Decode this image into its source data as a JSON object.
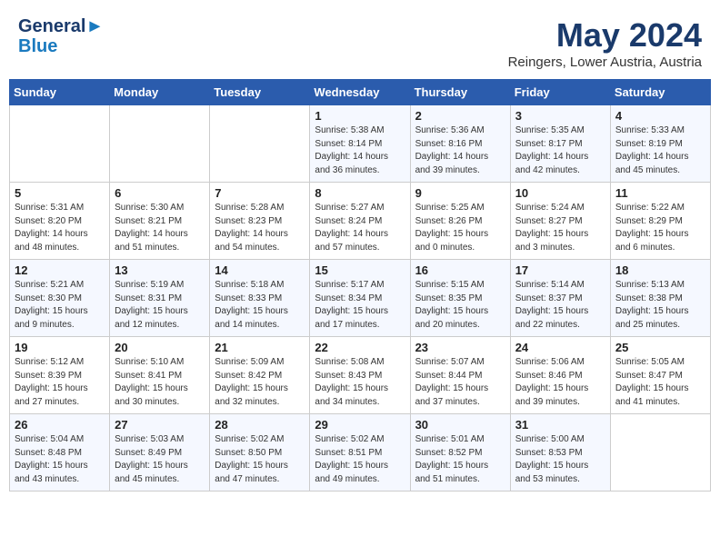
{
  "header": {
    "logo_line1": "General",
    "logo_line2": "Blue",
    "title": "May 2024",
    "subtitle": "Reingers, Lower Austria, Austria"
  },
  "weekdays": [
    "Sunday",
    "Monday",
    "Tuesday",
    "Wednesday",
    "Thursday",
    "Friday",
    "Saturday"
  ],
  "weeks": [
    [
      {
        "day": "",
        "info": ""
      },
      {
        "day": "",
        "info": ""
      },
      {
        "day": "",
        "info": ""
      },
      {
        "day": "1",
        "info": "Sunrise: 5:38 AM\nSunset: 8:14 PM\nDaylight: 14 hours\nand 36 minutes."
      },
      {
        "day": "2",
        "info": "Sunrise: 5:36 AM\nSunset: 8:16 PM\nDaylight: 14 hours\nand 39 minutes."
      },
      {
        "day": "3",
        "info": "Sunrise: 5:35 AM\nSunset: 8:17 PM\nDaylight: 14 hours\nand 42 minutes."
      },
      {
        "day": "4",
        "info": "Sunrise: 5:33 AM\nSunset: 8:19 PM\nDaylight: 14 hours\nand 45 minutes."
      }
    ],
    [
      {
        "day": "5",
        "info": "Sunrise: 5:31 AM\nSunset: 8:20 PM\nDaylight: 14 hours\nand 48 minutes."
      },
      {
        "day": "6",
        "info": "Sunrise: 5:30 AM\nSunset: 8:21 PM\nDaylight: 14 hours\nand 51 minutes."
      },
      {
        "day": "7",
        "info": "Sunrise: 5:28 AM\nSunset: 8:23 PM\nDaylight: 14 hours\nand 54 minutes."
      },
      {
        "day": "8",
        "info": "Sunrise: 5:27 AM\nSunset: 8:24 PM\nDaylight: 14 hours\nand 57 minutes."
      },
      {
        "day": "9",
        "info": "Sunrise: 5:25 AM\nSunset: 8:26 PM\nDaylight: 15 hours\nand 0 minutes."
      },
      {
        "day": "10",
        "info": "Sunrise: 5:24 AM\nSunset: 8:27 PM\nDaylight: 15 hours\nand 3 minutes."
      },
      {
        "day": "11",
        "info": "Sunrise: 5:22 AM\nSunset: 8:29 PM\nDaylight: 15 hours\nand 6 minutes."
      }
    ],
    [
      {
        "day": "12",
        "info": "Sunrise: 5:21 AM\nSunset: 8:30 PM\nDaylight: 15 hours\nand 9 minutes."
      },
      {
        "day": "13",
        "info": "Sunrise: 5:19 AM\nSunset: 8:31 PM\nDaylight: 15 hours\nand 12 minutes."
      },
      {
        "day": "14",
        "info": "Sunrise: 5:18 AM\nSunset: 8:33 PM\nDaylight: 15 hours\nand 14 minutes."
      },
      {
        "day": "15",
        "info": "Sunrise: 5:17 AM\nSunset: 8:34 PM\nDaylight: 15 hours\nand 17 minutes."
      },
      {
        "day": "16",
        "info": "Sunrise: 5:15 AM\nSunset: 8:35 PM\nDaylight: 15 hours\nand 20 minutes."
      },
      {
        "day": "17",
        "info": "Sunrise: 5:14 AM\nSunset: 8:37 PM\nDaylight: 15 hours\nand 22 minutes."
      },
      {
        "day": "18",
        "info": "Sunrise: 5:13 AM\nSunset: 8:38 PM\nDaylight: 15 hours\nand 25 minutes."
      }
    ],
    [
      {
        "day": "19",
        "info": "Sunrise: 5:12 AM\nSunset: 8:39 PM\nDaylight: 15 hours\nand 27 minutes."
      },
      {
        "day": "20",
        "info": "Sunrise: 5:10 AM\nSunset: 8:41 PM\nDaylight: 15 hours\nand 30 minutes."
      },
      {
        "day": "21",
        "info": "Sunrise: 5:09 AM\nSunset: 8:42 PM\nDaylight: 15 hours\nand 32 minutes."
      },
      {
        "day": "22",
        "info": "Sunrise: 5:08 AM\nSunset: 8:43 PM\nDaylight: 15 hours\nand 34 minutes."
      },
      {
        "day": "23",
        "info": "Sunrise: 5:07 AM\nSunset: 8:44 PM\nDaylight: 15 hours\nand 37 minutes."
      },
      {
        "day": "24",
        "info": "Sunrise: 5:06 AM\nSunset: 8:46 PM\nDaylight: 15 hours\nand 39 minutes."
      },
      {
        "day": "25",
        "info": "Sunrise: 5:05 AM\nSunset: 8:47 PM\nDaylight: 15 hours\nand 41 minutes."
      }
    ],
    [
      {
        "day": "26",
        "info": "Sunrise: 5:04 AM\nSunset: 8:48 PM\nDaylight: 15 hours\nand 43 minutes."
      },
      {
        "day": "27",
        "info": "Sunrise: 5:03 AM\nSunset: 8:49 PM\nDaylight: 15 hours\nand 45 minutes."
      },
      {
        "day": "28",
        "info": "Sunrise: 5:02 AM\nSunset: 8:50 PM\nDaylight: 15 hours\nand 47 minutes."
      },
      {
        "day": "29",
        "info": "Sunrise: 5:02 AM\nSunset: 8:51 PM\nDaylight: 15 hours\nand 49 minutes."
      },
      {
        "day": "30",
        "info": "Sunrise: 5:01 AM\nSunset: 8:52 PM\nDaylight: 15 hours\nand 51 minutes."
      },
      {
        "day": "31",
        "info": "Sunrise: 5:00 AM\nSunset: 8:53 PM\nDaylight: 15 hours\nand 53 minutes."
      },
      {
        "day": "",
        "info": ""
      }
    ]
  ]
}
